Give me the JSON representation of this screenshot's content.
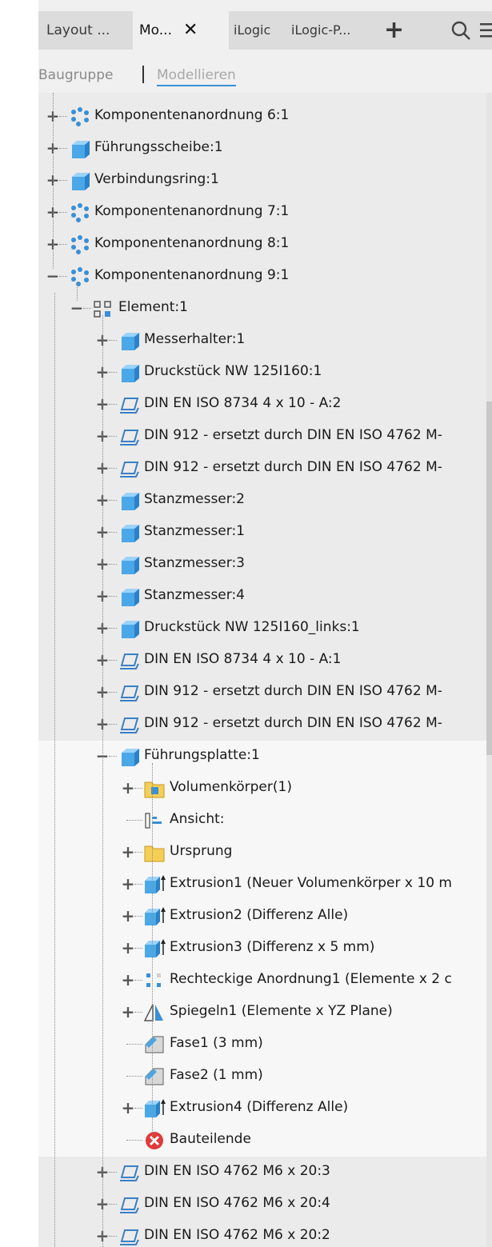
{
  "tabs": [
    "Layout ...",
    "Mo...",
    "iLogic",
    "iLogic-P..."
  ],
  "tab_close": "✕",
  "tab_add": "+",
  "modes": [
    "Baugruppe",
    "Modellieren"
  ],
  "tree": {
    "rows": [
      {
        "label": "Komponentenanordnung 6:1",
        "icon": "pattern-icon",
        "level": 0,
        "state": "collapsed"
      },
      {
        "label": "Führungsscheibe:1",
        "icon": "part-icon",
        "level": 0,
        "state": "collapsed"
      },
      {
        "label": "Verbindungsring:1",
        "icon": "part-icon",
        "level": 0,
        "state": "collapsed"
      },
      {
        "label": "Komponentenanordnung 7:1",
        "icon": "pattern-icon",
        "level": 0,
        "state": "collapsed"
      },
      {
        "label": "Komponentenanordnung 8:1",
        "icon": "pattern-icon",
        "level": 0,
        "state": "collapsed"
      },
      {
        "label": "Komponentenanordnung 9:1",
        "icon": "pattern-icon",
        "level": 0,
        "state": "expanded"
      },
      {
        "label": "Element:1",
        "icon": "element-icon",
        "level": 1,
        "state": "expanded"
      },
      {
        "label": "Messerhalter:1",
        "icon": "part-icon",
        "level": 2,
        "state": "collapsed"
      },
      {
        "label": "Druckstück NW 125I160:1",
        "icon": "part-icon",
        "level": 2,
        "state": "collapsed"
      },
      {
        "label": "DIN EN ISO 8734 4 x 10 - A:2",
        "icon": "content-center-icon",
        "level": 2,
        "state": "collapsed"
      },
      {
        "label": "DIN 912 - ersetzt durch DIN EN ISO 4762 M-",
        "icon": "content-center-icon",
        "level": 2,
        "state": "collapsed"
      },
      {
        "label": "DIN 912 - ersetzt durch DIN EN ISO 4762 M-",
        "icon": "content-center-icon",
        "level": 2,
        "state": "collapsed"
      },
      {
        "label": "Stanzmesser:2",
        "icon": "part-icon",
        "level": 2,
        "state": "collapsed"
      },
      {
        "label": "Stanzmesser:1",
        "icon": "part-icon",
        "level": 2,
        "state": "collapsed"
      },
      {
        "label": "Stanzmesser:3",
        "icon": "part-icon",
        "level": 2,
        "state": "collapsed"
      },
      {
        "label": "Stanzmesser:4",
        "icon": "part-icon",
        "level": 2,
        "state": "collapsed"
      },
      {
        "label": "Druckstück NW 125I160_links:1",
        "icon": "part-icon",
        "level": 2,
        "state": "collapsed"
      },
      {
        "label": "DIN EN ISO 8734 4 x 10 - A:1",
        "icon": "content-center-icon",
        "level": 2,
        "state": "collapsed"
      },
      {
        "label": "DIN 912 - ersetzt durch DIN EN ISO 4762 M-",
        "icon": "content-center-icon",
        "level": 2,
        "state": "collapsed"
      },
      {
        "label": "DIN 912 - ersetzt durch DIN EN ISO 4762 M-",
        "icon": "content-center-icon",
        "level": 2,
        "state": "collapsed"
      },
      {
        "label": "Führungsplatte:1",
        "icon": "part-icon",
        "level": 2,
        "state": "expanded"
      },
      {
        "label": "Volumenkörper(1)",
        "icon": "solid-bodies-folder-icon",
        "level": 3,
        "state": "collapsed"
      },
      {
        "label": "Ansicht:",
        "icon": "view-rep-icon",
        "level": 3,
        "state": "none"
      },
      {
        "label": "Ursprung",
        "icon": "folder-icon",
        "level": 3,
        "state": "collapsed"
      },
      {
        "label": "Extrusion1 (Neuer Volumenkörper x 10 m",
        "icon": "extrude-icon",
        "level": 3,
        "state": "collapsed"
      },
      {
        "label": "Extrusion2 (Differenz Alle)",
        "icon": "extrude-icon",
        "level": 3,
        "state": "collapsed"
      },
      {
        "label": "Extrusion3 (Differenz x 5 mm)",
        "icon": "extrude-icon",
        "level": 3,
        "state": "collapsed"
      },
      {
        "label": "Rechteckige Anordnung1 (Elemente x 2 c",
        "icon": "rect-pattern-icon",
        "level": 3,
        "state": "collapsed"
      },
      {
        "label": "Spiegeln1 (Elemente x YZ Plane)",
        "icon": "mirror-icon",
        "level": 3,
        "state": "collapsed"
      },
      {
        "label": "Fase1 (3 mm)",
        "icon": "chamfer-icon",
        "level": 3,
        "state": "none"
      },
      {
        "label": "Fase2 (1 mm)",
        "icon": "chamfer-icon",
        "level": 3,
        "state": "none"
      },
      {
        "label": "Extrusion4 (Differenz Alle)",
        "icon": "extrude-icon",
        "level": 3,
        "state": "collapsed"
      },
      {
        "label": "Bauteilende",
        "icon": "end-of-part-icon",
        "level": 3,
        "state": "none"
      },
      {
        "label": "DIN EN ISO 4762 M6 x 20:3",
        "icon": "content-center-icon",
        "level": 2,
        "state": "collapsed"
      },
      {
        "label": "DIN EN ISO 4762 M6 x 20:4",
        "icon": "content-center-icon",
        "level": 2,
        "state": "collapsed"
      },
      {
        "label": "DIN EN ISO 4762 M6 x 20:2",
        "icon": "content-center-icon",
        "level": 2,
        "state": "collapsed"
      }
    ]
  },
  "colors": {
    "part_blue": "#4aa8e8",
    "folder_yellow": "#f5cf55",
    "end_red": "#e03a3a",
    "mode_underline": "#3c8fd6"
  }
}
